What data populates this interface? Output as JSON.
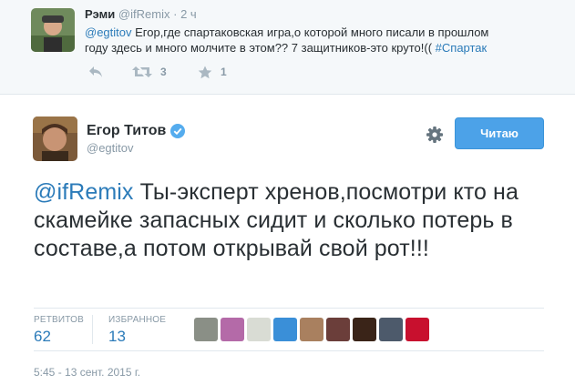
{
  "reply_tweet": {
    "name": "Рэми",
    "handle": "@ifRemix",
    "separator": "·",
    "time": "2 ч",
    "mention": "@egtitov",
    "text_line1": " Егор,где спартаковская игра,о которой много писали в прошлом",
    "text_line2": "году здесь и много молчите в этом?? 7 защитников-это круто!((",
    "hashtag": "#Спартак",
    "retweet_count": "3",
    "favorite_count": "1"
  },
  "main_tweet": {
    "name": "Егор Титов",
    "handle": "@egtitov",
    "follow_button": "Читаю",
    "mention": "@ifRemix",
    "text": " Ты-эксперт хренов,посмотри кто на скамейке запасных сидит и сколько потерь в составе,а потом открывай свой рот!!!",
    "stats": {
      "retweets_label": "РЕТВИТОВ",
      "retweets_value": "62",
      "favorites_label": "ИЗБРАННОЕ",
      "favorites_value": "13"
    },
    "timestamp": "5:45 - 13 сент. 2015 г."
  },
  "favoriters": [
    {
      "name": "favoriter-avatar-1",
      "color": "#8a8f86"
    },
    {
      "name": "favoriter-avatar-2",
      "color": "#b46aa8"
    },
    {
      "name": "favoriter-avatar-3",
      "color": "#d9dcd4"
    },
    {
      "name": "favoriter-avatar-4",
      "color": "#3a8fd8"
    },
    {
      "name": "favoriter-avatar-5",
      "color": "#a9805f"
    },
    {
      "name": "favoriter-avatar-6",
      "color": "#6b3e3a"
    },
    {
      "name": "favoriter-avatar-7",
      "color": "#3a2418"
    },
    {
      "name": "favoriter-avatar-8",
      "color": "#4d5a6b"
    },
    {
      "name": "favoriter-avatar-9",
      "color": "#c8102e"
    }
  ],
  "colors": {
    "link": "#2b7bb9",
    "follow_button": "#4ca2e8",
    "verified": "#55acee",
    "muted": "#8899a6"
  },
  "icons": [
    "reply-icon",
    "retweet-icon",
    "favorite-icon",
    "verified-badge-icon",
    "gear-icon"
  ]
}
